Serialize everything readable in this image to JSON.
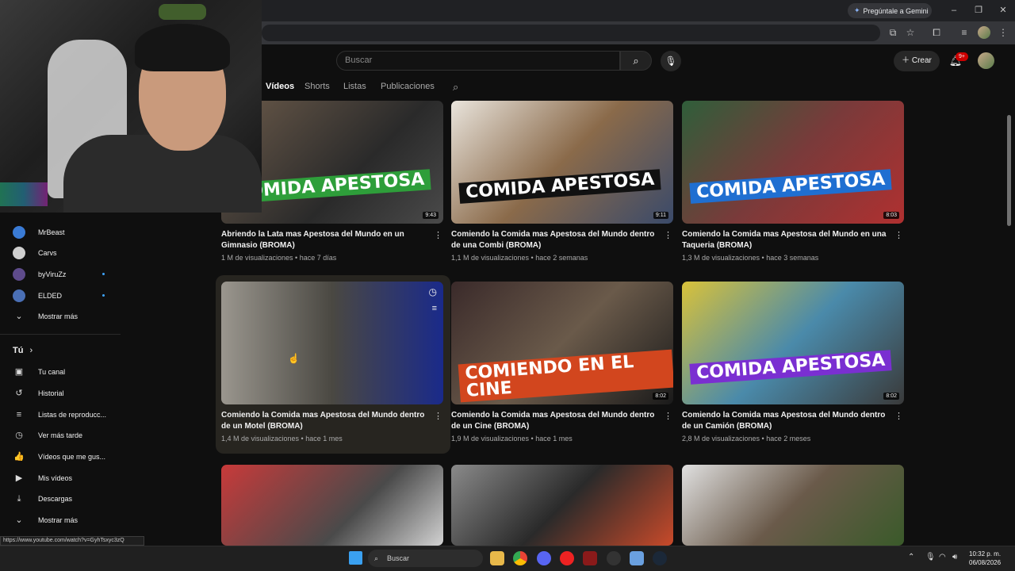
{
  "browser": {
    "gemini_label": "Pregúntale a Gemini",
    "status_url": "https://www.youtube.com/watch?v=GyhTsxyc3zQ"
  },
  "header": {
    "search_placeholder": "Buscar",
    "create_label": "Crear",
    "notifications_badge": "9+"
  },
  "tabs": [
    {
      "label": "Vídeos",
      "active": true
    },
    {
      "label": "Shorts"
    },
    {
      "label": "Listas"
    },
    {
      "label": "Publicaciones"
    }
  ],
  "sidebar": {
    "subscriptions": [
      {
        "label": "MrBeast",
        "color": "#3a7bd5"
      },
      {
        "label": "Carvs",
        "color": "#cfcfcf"
      },
      {
        "label": "byViruZz",
        "color": "#5e4b8b"
      },
      {
        "label": "ELDED",
        "color": "#4a6fb5"
      }
    ],
    "show_more_1": "Mostrar más",
    "you_label": "Tú",
    "you_items": [
      {
        "label": "Tu canal",
        "icon": "account-box-icon",
        "glyph": "▣"
      },
      {
        "label": "Historial",
        "icon": "history-icon",
        "glyph": "↺"
      },
      {
        "label": "Listas de reproducc...",
        "icon": "playlist-icon",
        "glyph": "≡"
      },
      {
        "label": "Ver más tarde",
        "icon": "clock-icon",
        "glyph": "◷"
      },
      {
        "label": "Vídeos que me gus...",
        "icon": "thumbs-up-icon",
        "glyph": "👍"
      },
      {
        "label": "Mis vídeos",
        "icon": "my-videos-icon",
        "glyph": "▶"
      },
      {
        "label": "Descargas",
        "icon": "download-icon",
        "glyph": "⤓"
      }
    ],
    "show_more_2": "Mostrar más"
  },
  "videos": [
    {
      "title": "Abriendo la Lata mas Apestosa del Mundo en un Gimnasio (BROMA)",
      "meta": "1 M de visualizaciones • hace 7 días",
      "duration": "9:43",
      "overlay": "COMIDA APESTOSA",
      "bg": "linear-gradient(135deg,#6b5a4a,#2a2a2a 60%,#4a4a4a)",
      "ovbg": "#2e9e3a"
    },
    {
      "title": "Comiendo la Comida mas Apestosa del Mundo dentro de una Combi (BROMA)",
      "meta": "1,1 M de visualizaciones • hace 2 semanas",
      "duration": "9:11",
      "overlay": "COMIDA APESTOSA",
      "bg": "linear-gradient(135deg,#e9e4dc,#8a6a4a 50%,#3a4a6a)",
      "ovbg": "#111111"
    },
    {
      "title": "Comiendo la Comida mas Apestosa del Mundo en una Taqueria (BROMA)",
      "meta": "1,3 M de visualizaciones • hace 3 semanas",
      "duration": "8:03",
      "overlay": "COMIDA APESTOSA",
      "bg": "linear-gradient(135deg,#2f5e3a,#7a3a3a 50%,#b03030)",
      "ovbg": "#1f6fd1"
    },
    {
      "title": "Comiendo la Comida mas Apestosa del Mundo dentro de un Motel (BROMA)",
      "meta": "1,4 M de visualizaciones • hace 1 mes",
      "duration": "",
      "overlay": "",
      "bg": "linear-gradient(90deg,#9a968e,#4a4842 50%,#1a2a8a)",
      "ovbg": ""
    },
    {
      "title": "Comiendo la Comida mas Apestosa del Mundo dentro de un Cine (BROMA)",
      "meta": "1,9 M de visualizaciones • hace 1 mes",
      "duration": "8:02",
      "overlay": "COMIENDO EN EL CINE",
      "bg": "linear-gradient(135deg,#3a2a2a,#6a5a4a 50%,#1a1a1a)",
      "ovbg": "#d2461e"
    },
    {
      "title": "Comiendo la Comida mas Apestosa del Mundo dentro de un Camión (BROMA)",
      "meta": "2,8 M de visualizaciones • hace 2 meses",
      "duration": "8:02",
      "overlay": "COMIDA APESTOSA",
      "bg": "linear-gradient(135deg,#d9c23a,#4a8aaa 50%,#3a3a3a)",
      "ovbg": "#7a2fd1"
    },
    {
      "title": "",
      "meta": "",
      "duration": "",
      "overlay": "",
      "bg": "linear-gradient(135deg,#c83a3a,#4a4a4a 60%,#d2d2d2)",
      "ovbg": ""
    },
    {
      "title": "",
      "meta": "",
      "duration": "",
      "overlay": "",
      "bg": "linear-gradient(135deg,#8a8a8a,#2a2a2a 50%,#c84a2a)",
      "ovbg": ""
    },
    {
      "title": "",
      "meta": "",
      "duration": "",
      "overlay": "",
      "bg": "linear-gradient(135deg,#e0e0e0,#6a5a4a 50%,#3a5a2a)",
      "ovbg": ""
    }
  ],
  "taskbar": {
    "search_placeholder": "Buscar",
    "time": "10:32 p. m.",
    "date": "06/08/2026"
  }
}
